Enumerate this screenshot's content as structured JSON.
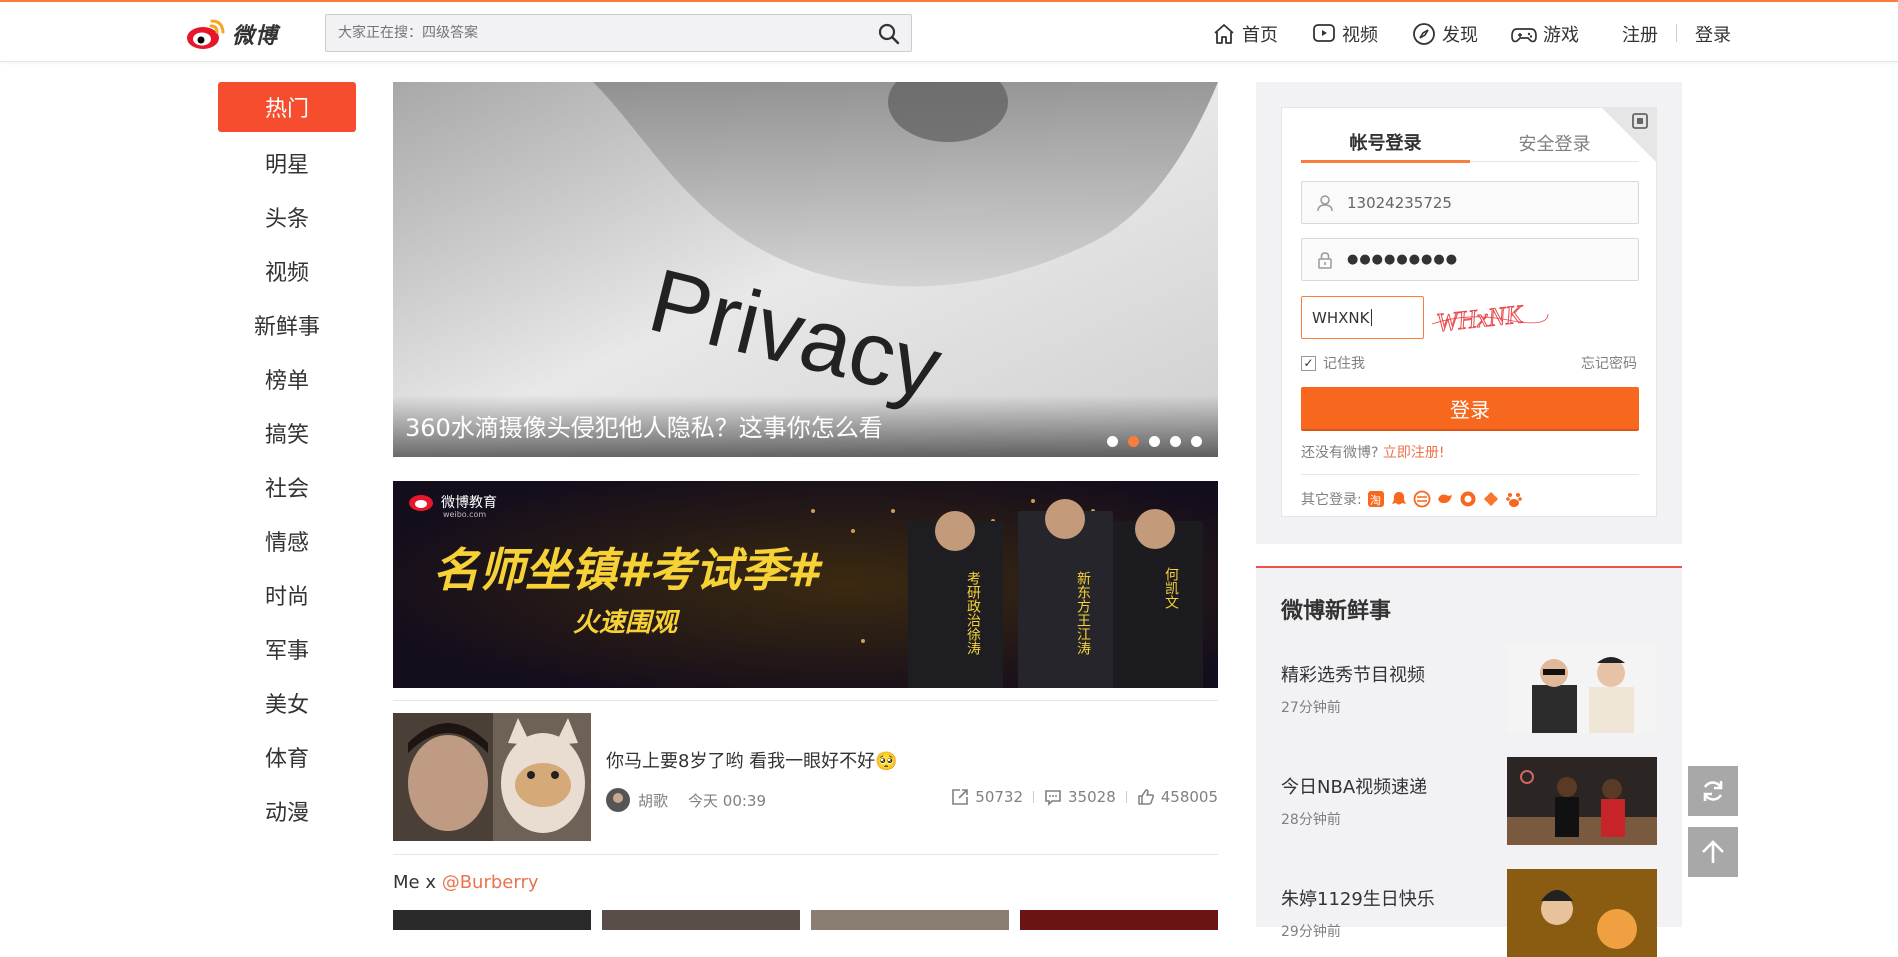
{
  "header": {
    "logo_text": "微博",
    "search_placeholder": "大家正在搜：四级答案",
    "nav": {
      "home": "首页",
      "video": "视频",
      "discover": "发现",
      "games": "游戏",
      "register": "注册",
      "login": "登录"
    }
  },
  "left_nav": [
    "热门",
    "明星",
    "头条",
    "视频",
    "新鲜事",
    "榜单",
    "搞笑",
    "社会",
    "情感",
    "时尚",
    "军事",
    "美女",
    "体育",
    "动漫"
  ],
  "hero": {
    "caption": "360水滴摄像头侵犯他人隐私？这事你怎么看",
    "image_text": "Privacy",
    "dots": 5,
    "active_dot": 2
  },
  "banner": {
    "logo_text": "微博教育",
    "logo_sub": "weibo.com",
    "headline": "名师坐镇#考试季#",
    "subline": "火速围观",
    "teachers": [
      "考研政治徐涛",
      "新东方王江涛",
      "何凯文"
    ]
  },
  "feed": {
    "text": "你马上要8岁了哟 看我一眼好不好",
    "emoji": "🥺",
    "author": "胡歌",
    "time": "今天 00:39",
    "reposts": "50732",
    "comments": "35028",
    "likes": "458005"
  },
  "burberry": {
    "prefix": "Me x ",
    "mention": "@Burberry"
  },
  "login": {
    "tab_account": "帐号登录",
    "tab_secure": "安全登录",
    "username": "13024235725",
    "password": "●●●●●●●●●",
    "captcha_input": "WHXNK",
    "captcha_image_text": "WHxNK",
    "remember": "记住我",
    "forgot": "忘记密码",
    "login_button": "登录",
    "no_account": "还没有微博?",
    "register_now": "立即注册!",
    "other_login": "其它登录:"
  },
  "fresh": {
    "title": "微博新鲜事",
    "items": [
      {
        "title": "精彩选秀节目视频",
        "time": "27分钟前"
      },
      {
        "title": "今日NBA视频速递",
        "time": "28分钟前"
      },
      {
        "title": "朱婷1129生日快乐",
        "time": "29分钟前"
      }
    ]
  },
  "colors": {
    "accent": "#fa7d3c",
    "hot": "#f74d2f",
    "link": "#eb7350"
  }
}
